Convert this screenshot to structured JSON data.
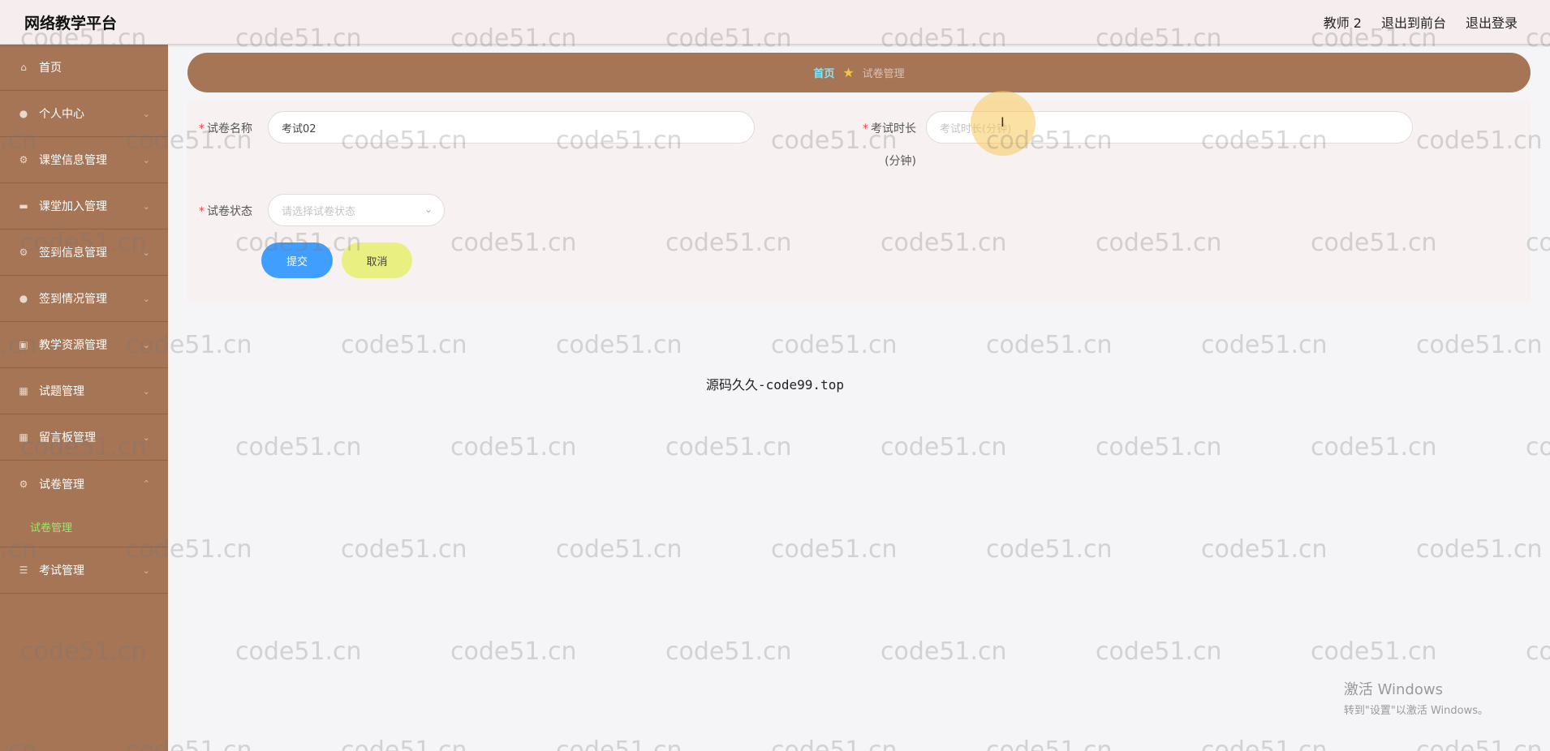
{
  "header": {
    "app_title": "网络教学平台",
    "user": "教师 2",
    "to_front": "退出到前台",
    "logout": "退出登录"
  },
  "sidebar": {
    "items": [
      {
        "label": "首页",
        "icon": "home-icon"
      },
      {
        "label": "个人中心",
        "icon": "user-icon"
      },
      {
        "label": "课堂信息管理",
        "icon": "settings-icon"
      },
      {
        "label": "课堂加入管理",
        "icon": "folder-icon"
      },
      {
        "label": "签到信息管理",
        "icon": "settings-icon"
      },
      {
        "label": "签到情况管理",
        "icon": "user-icon"
      },
      {
        "label": "教学资源管理",
        "icon": "book-icon"
      },
      {
        "label": "试题管理",
        "icon": "grid-icon"
      },
      {
        "label": "留言板管理",
        "icon": "grid-icon"
      },
      {
        "label": "试卷管理",
        "icon": "settings-icon"
      }
    ],
    "active_submenu": "试卷管理",
    "last_item": {
      "label": "考试管理",
      "icon": "list-icon"
    }
  },
  "breadcrumb": {
    "home": "首页",
    "current": "试卷管理"
  },
  "form": {
    "paper_name_label": "试卷名称",
    "paper_name_value": "考试02",
    "duration_label": "考试时长",
    "duration_label_suffix": "(分钟)",
    "duration_placeholder": "考试时长(分钟)",
    "status_label": "试卷状态",
    "status_placeholder": "请选择试卷状态",
    "submit": "提交",
    "cancel": "取消"
  },
  "footer_text": "源码久久-code99.top",
  "watermark": "code51.cn",
  "windows_activation": {
    "line1": "激活 Windows",
    "line2": "转到\"设置\"以激活 Windows。"
  },
  "colors": {
    "sidebar_bg": "#a57556",
    "breadcrumb_bg": "#a57556",
    "submit_bg": "#409eff",
    "cancel_bg": "#e9ef80",
    "active_submenu": "#9be86a"
  }
}
